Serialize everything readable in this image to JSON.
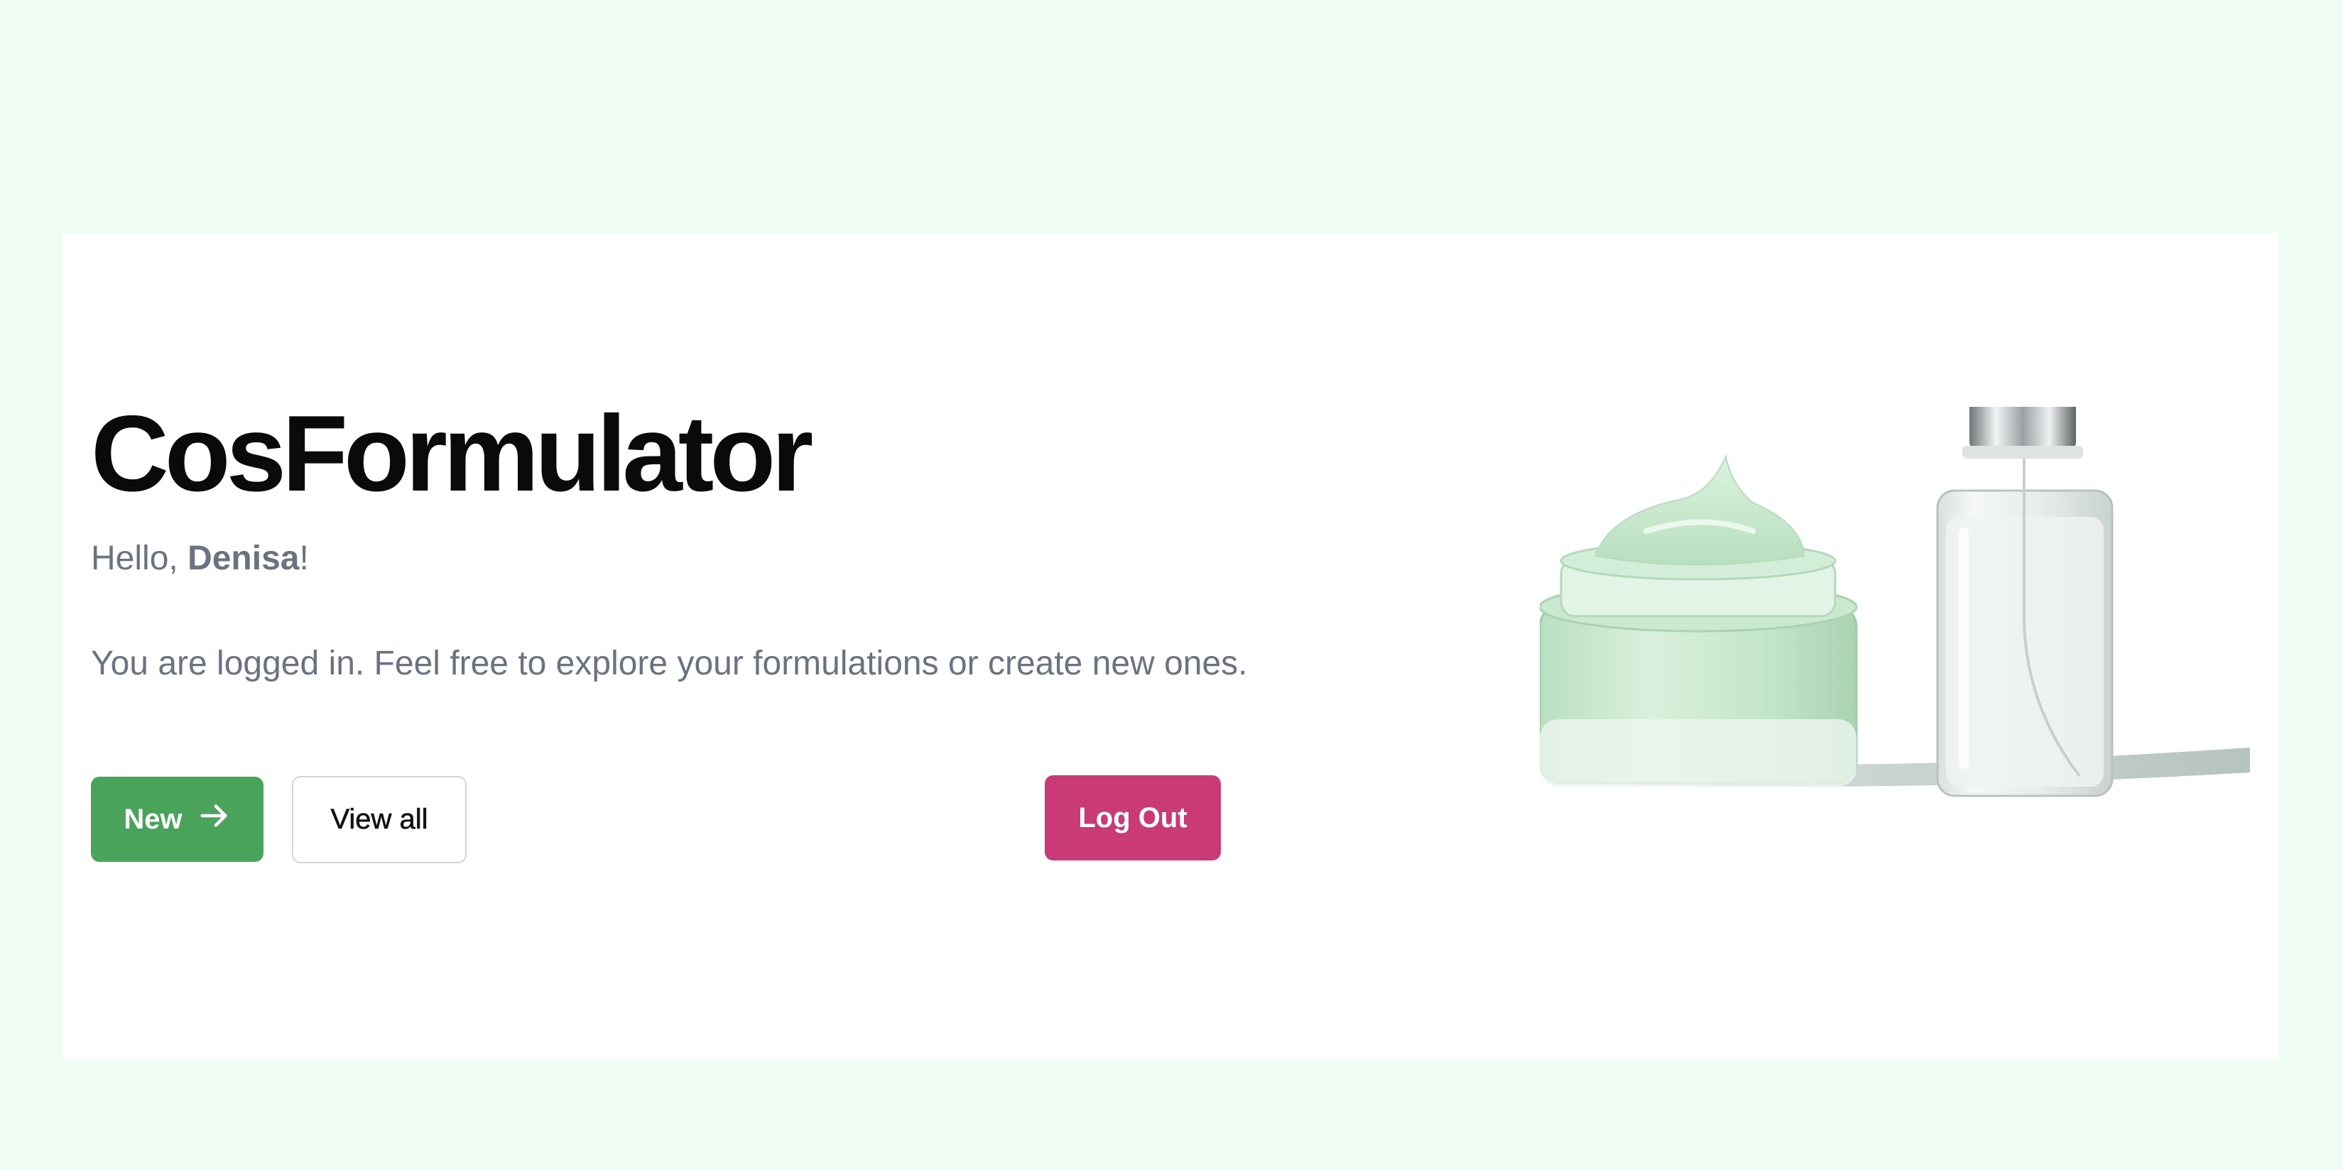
{
  "app": {
    "title": "CosFormulator"
  },
  "greeting": {
    "prefix": "Hello, ",
    "name": "Denisa",
    "suffix": "!"
  },
  "intro": {
    "text": "You are logged in. Feel free to explore your formulations or create new ones."
  },
  "actions": {
    "new_label": "New",
    "view_all_label": "View all",
    "logout_label": "Log Out"
  },
  "icons": {
    "new_button_icon": "arrow-right-icon",
    "product_image": "cosmetic-products-illustration"
  },
  "colors": {
    "page_background": "#f0fdf4",
    "card_background": "#ffffff",
    "new_button": "#4aa35b",
    "logout_button": "#c93a76",
    "muted_text": "#6b7280"
  }
}
